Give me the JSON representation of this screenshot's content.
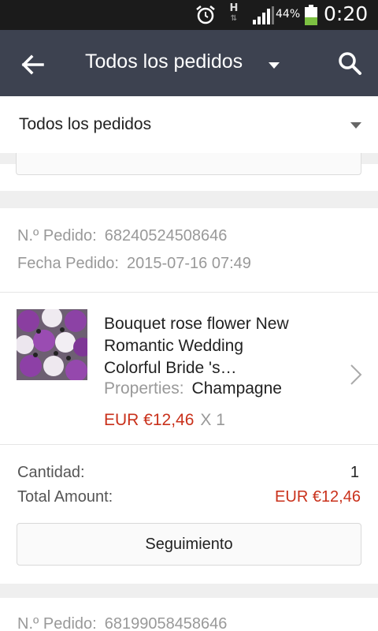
{
  "status_bar": {
    "network_type": "H",
    "battery_percent": "44%",
    "battery_level": 0.44,
    "time": "0:20"
  },
  "app_bar": {
    "title": "Todos los pedidos"
  },
  "filter": {
    "selected": "Todos los pedidos"
  },
  "orders": [
    {
      "order_no_label": "N.º Pedido:",
      "order_no": "68240524508646",
      "date_label": "Fecha Pedido:",
      "date": "2015-07-16 07:49",
      "product": {
        "title": "Bouquet rose flower  New\nRomantic Wedding\nColorful Bride 's…",
        "properties_label": "Properties:",
        "properties_value": "Champagne",
        "price": "EUR €12,46",
        "quantity": "X 1"
      },
      "summary": {
        "quantity_label": "Cantidad:",
        "quantity_value": "1",
        "total_label": "Total Amount:",
        "total_value": "EUR €12,46"
      },
      "tracking_button": "Seguimiento"
    },
    {
      "order_no_label": "N.º Pedido:",
      "order_no": "68199058458646"
    }
  ],
  "colors": {
    "app_bar": "#3d4250",
    "price_red": "#c9311b",
    "battery_green": "#7dc142"
  }
}
